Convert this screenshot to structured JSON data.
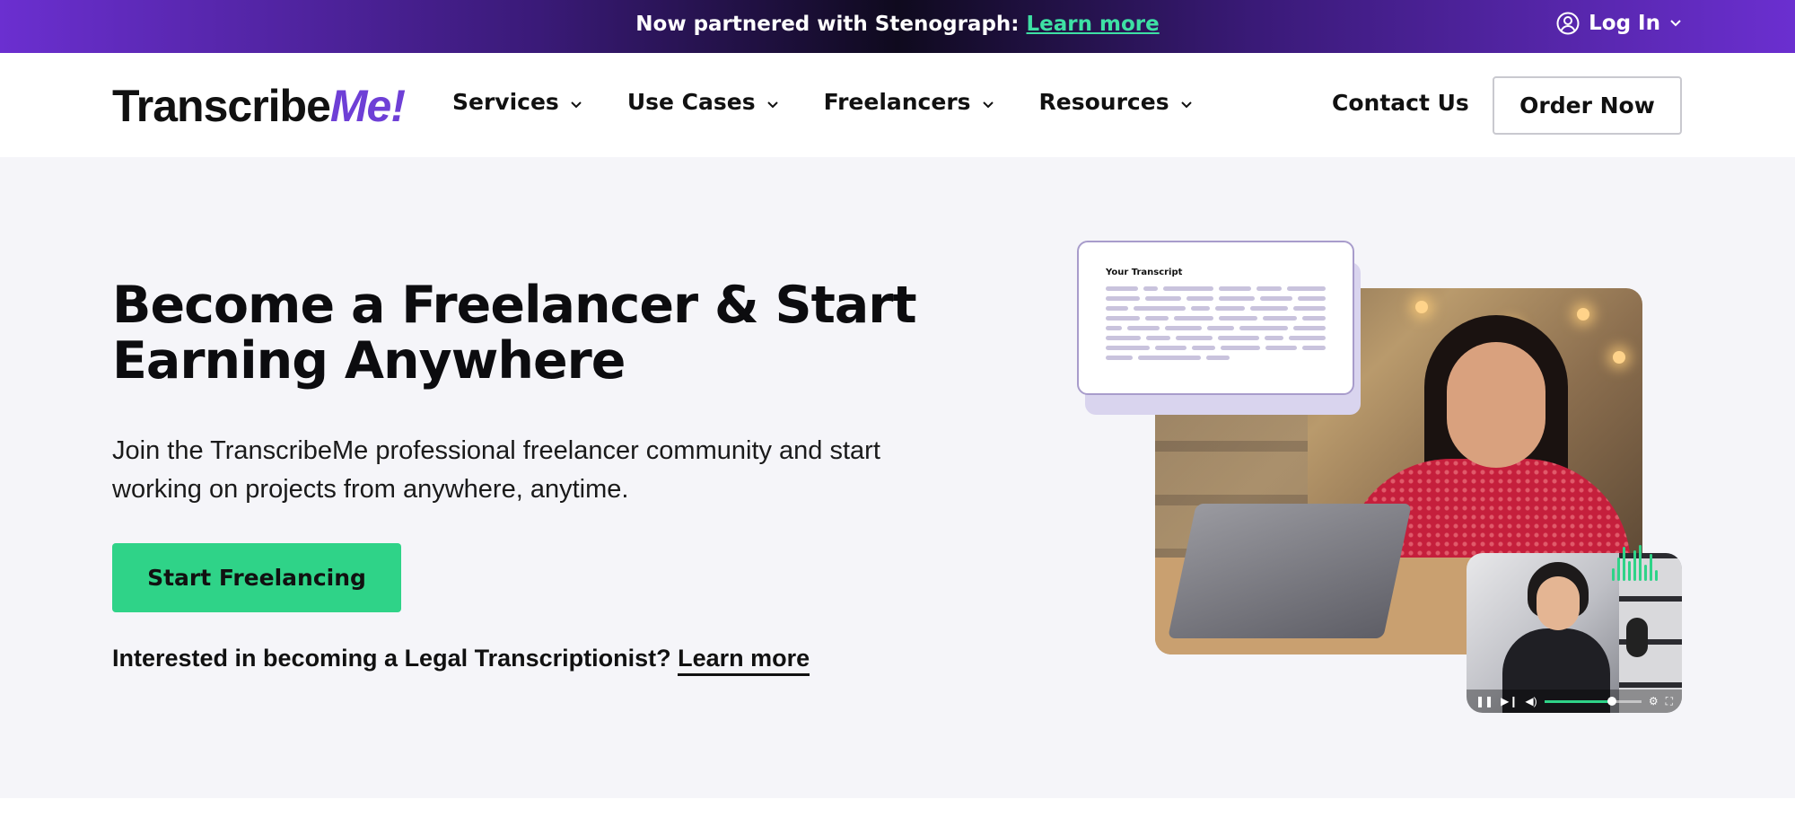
{
  "topbar": {
    "announcement": "Now partnered with Stenograph:",
    "announcement_link": "Learn more",
    "login_label": "Log In",
    "link_color": "#3ee0a4"
  },
  "header": {
    "logo_main": "Transcribe",
    "logo_accent": "Me!",
    "logo_accent_color": "#6e3fd6",
    "nav": [
      {
        "label": "Services"
      },
      {
        "label": "Use Cases"
      },
      {
        "label": "Freelancers"
      },
      {
        "label": "Resources"
      }
    ],
    "contact_label": "Contact Us",
    "order_label": "Order Now"
  },
  "hero": {
    "title": "Become a Freelancer & Start Earning Anywhere",
    "lead": "Join the TranscribeMe professional freelancer community and start working on projects from anywhere, anytime.",
    "cta_label": "Start Freelancing",
    "cta_color": "#2fd388",
    "legal_prompt": "Interested in becoming a Legal Transcriptionist?",
    "legal_link": "Learn more"
  },
  "illustration": {
    "transcript_title": "Your Transcript",
    "video_progress": 0.7
  }
}
